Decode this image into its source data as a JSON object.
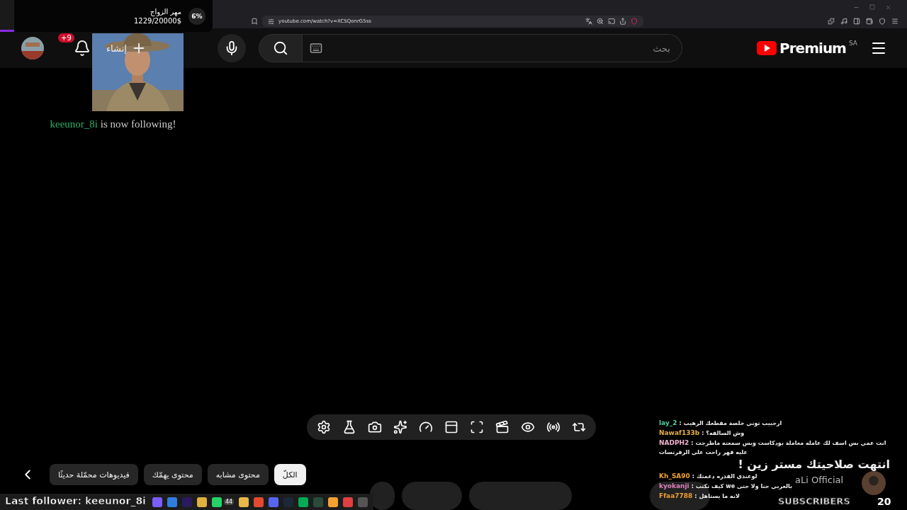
{
  "donation_goal": {
    "title": "مهر الزواج",
    "amount": "1229/20000$",
    "percent": "6%",
    "level": 0.06
  },
  "browser": {
    "url": "youtube.com/watch?v=XCSQonrG5ss"
  },
  "header": {
    "logo_text": "Premium",
    "region": "SA",
    "search": {
      "placeholder": "بحث"
    },
    "create_label": "إنشاء",
    "notification_badge": "+9"
  },
  "follow_alert": {
    "username": "keeunor_8i",
    "message": "is now following!"
  },
  "chips": [
    {
      "label": "الكلّ",
      "selected": true
    },
    {
      "label": "محتوى مشابه",
      "selected": false
    },
    {
      "label": "محتوى يهمّك",
      "selected": false
    },
    {
      "label": "فيديوهات محمّلة حديثًا",
      "selected": false
    }
  ],
  "chat": [
    {
      "user": "lay_2",
      "sep": ":",
      "color": "#4fd0a8",
      "text": "ارحبيب توني خلصة مقطعك الرهيب"
    },
    {
      "user": "Nawaf133b",
      "sep": ":",
      "color": "#e8b040",
      "text": "وش السالفه؟"
    },
    {
      "user": "NADPH2",
      "sep": ":",
      "color": "#f0b0d0",
      "text": "انت عمي بس اسف لك عامله معاملة بودكاست وبس سمعته ماطرجت عليه قهر راحت علي الرفرنسات"
    },
    {
      "user": "Kh_SA90",
      "sep": ":",
      "color": "#f0a030",
      "text": "لوعندي القدره دعمتك"
    },
    {
      "user": "kyokanji",
      "sep": ":",
      "color": "#e080c0",
      "text": "بالعربي حنا ولا حتى we كيف تكتب"
    },
    {
      "user": "Ffaa7788",
      "sep": ":",
      "color": "#f0a030",
      "text": "لانه ما يستاهل"
    }
  ],
  "expiry_banner": "انتهت صلاحيتك مستر زين !",
  "subscriber_widget": {
    "channel": "aLi Official",
    "label": "SUBSCRIBERS",
    "count": "20"
  },
  "taskbar": {
    "chat_badge": "44"
  },
  "last_follower": "Last follower: keeunor_8i"
}
